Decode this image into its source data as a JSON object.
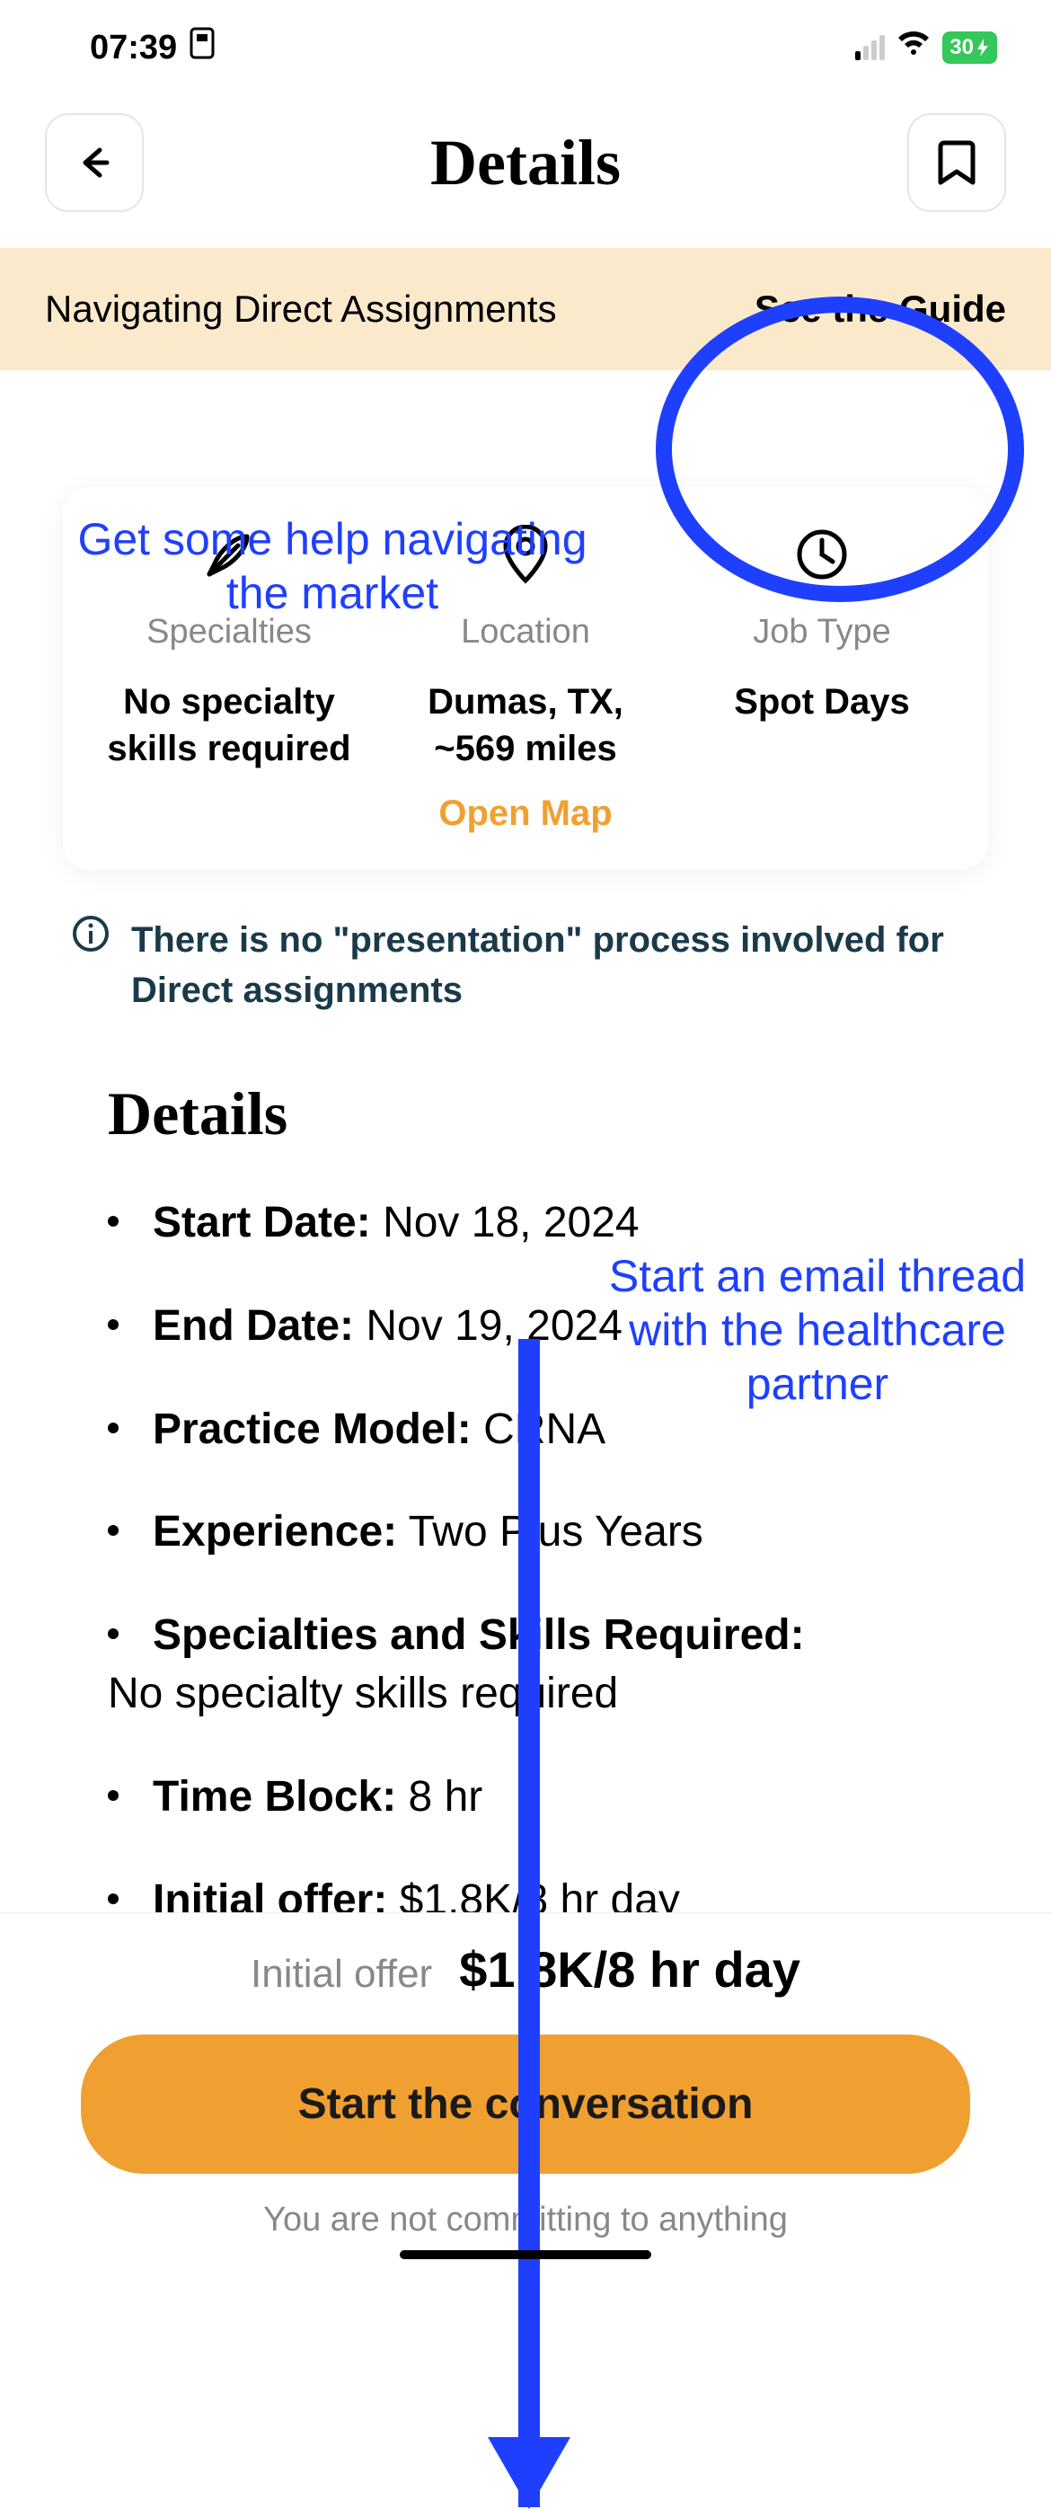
{
  "status": {
    "time": "07:39",
    "battery": "30"
  },
  "nav": {
    "title": "Details"
  },
  "banner": {
    "text": "Navigating Direct Assignments",
    "link": "See the Guide"
  },
  "annotations": {
    "help": "Get some help navigating the market",
    "email": "Start an email thread with the healthcare partner"
  },
  "summary": {
    "specialties": {
      "label": "Specialties",
      "value": "No specialty skills required"
    },
    "location": {
      "label": "Location",
      "value": "Dumas, TX, ~569 miles",
      "map_link": "Open Map"
    },
    "jobtype": {
      "label": "Job Type",
      "value": "Spot Days"
    }
  },
  "info_note": "There is no \"presentation\" process involved for Direct assignments",
  "details": {
    "heading": "Details",
    "start_date": {
      "label": "Start Date:",
      "value": "Nov 18, 2024"
    },
    "end_date": {
      "label": "End Date:",
      "value": "Nov 19, 2024"
    },
    "practice_model": {
      "label": "Practice Model:",
      "value": "CRNA"
    },
    "experience": {
      "label": "Experience:",
      "value": "Two Plus Years"
    },
    "specialties_skills": {
      "label": "Specialties and Skills Required:",
      "value": "No specialty skills required"
    },
    "time_block": {
      "label": "Time Block:",
      "value": "8 hr"
    },
    "initial_offer": {
      "label": "Initial offer:",
      "value": "$1.8K/8 hr day"
    }
  },
  "bottom": {
    "offer_label": "Initial offer",
    "offer_value": "$1.8K/8 hr day",
    "cta": "Start the conversation",
    "sub": "You are not committing to anything"
  }
}
